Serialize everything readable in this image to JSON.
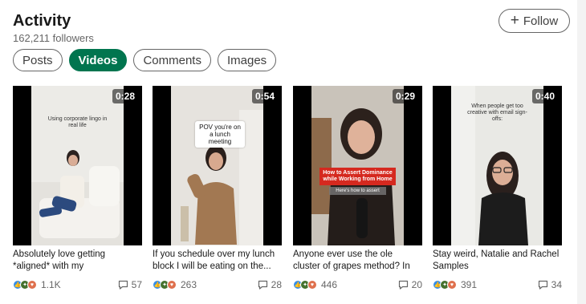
{
  "header": {
    "title": "Activity",
    "followers": "162,211 followers"
  },
  "follow_button": {
    "label": "Follow",
    "icon": "plus-icon"
  },
  "tabs": [
    {
      "label": "Posts",
      "active": false
    },
    {
      "label": "Videos",
      "active": true
    },
    {
      "label": "Comments",
      "active": false
    },
    {
      "label": "Images",
      "active": false
    }
  ],
  "colors": {
    "accent": "#01754f",
    "like": "#378fe9",
    "celebrate": "#44712e",
    "love": "#df704d"
  },
  "videos": [
    {
      "duration": "0:28",
      "overlay": "Using corporate lingo in real life",
      "caption": "Absolutely love getting *aligned* with my roommates....",
      "reactions": "1.1K",
      "comments": "57"
    },
    {
      "duration": "0:54",
      "overlay": "POV you're on a lunch meeting",
      "caption": "If you schedule over my lunch block I will be eating on the...",
      "reactions": "263",
      "comments": "28"
    },
    {
      "duration": "0:29",
      "overlay": "How to Assert Dominance while Working from Home",
      "overlay_sub": "Here's how to assert",
      "caption": "Anyone ever use the ole cluster of grapes method? In this...",
      "reactions": "446",
      "comments": "20"
    },
    {
      "duration": "0:40",
      "overlay": "When people get too creative with email sign-offs:",
      "caption": "Stay weird, Natalie and Rachel Samples",
      "reactions": "391",
      "comments": "34"
    }
  ]
}
